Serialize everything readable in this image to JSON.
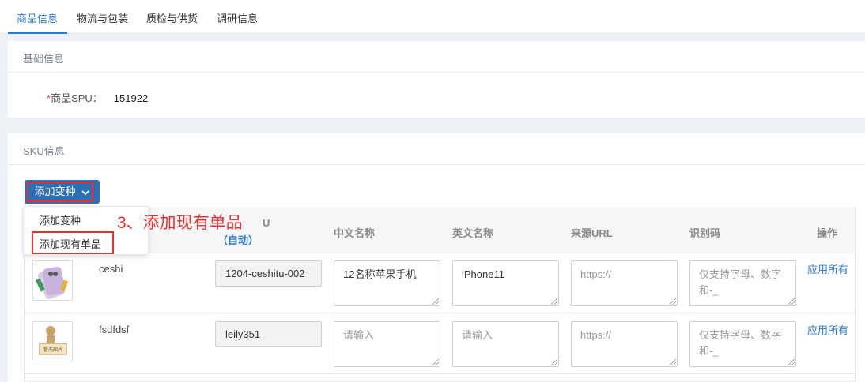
{
  "tabs": [
    {
      "label": "商品信息",
      "active": true
    },
    {
      "label": "物流与包装",
      "active": false
    },
    {
      "label": "质检与供货",
      "active": false
    },
    {
      "label": "调研信息",
      "active": false
    }
  ],
  "basic": {
    "title": "基础信息",
    "spu_required_mark": "*",
    "spu_label": "商品SPU：",
    "spu_value": "151922"
  },
  "sku": {
    "title": "SKU信息",
    "add_variant_button": "添加变种",
    "dropdown": {
      "items": [
        "添加变种",
        "添加现有单品"
      ]
    },
    "annotation": "3、添加现有单品",
    "columns": {
      "sku_partial": "U",
      "sku_sub": "（自动）",
      "cn_name": "中文名称",
      "en_name": "英文名称",
      "source_url": "来源URL",
      "code": "识别码",
      "action": "操作"
    },
    "rows": [
      {
        "image": "phone-image",
        "name": "ceshi",
        "sku_code": "1204-ceshitu-002",
        "cn_name": "12名称苹果手机",
        "cn_placeholder": false,
        "en_name": "iPhone11",
        "en_placeholder": false,
        "url": "https://",
        "code_line1": "仅支持字母、数字",
        "code_line2": "和-_",
        "action": "应用所有"
      },
      {
        "image": "no-image-placeholder",
        "image_caption": "暂无图片",
        "name": "fsdfdsf",
        "sku_code": "leily351",
        "cn_name": "请输入",
        "cn_placeholder": true,
        "en_name": "请输入",
        "en_placeholder": true,
        "url": "https://",
        "code_line1": "仅支持字母、数字",
        "code_line2": "和-_",
        "action": "应用所有"
      }
    ]
  },
  "colors": {
    "accent": "#2d7ad0",
    "button": "#2d6fb5",
    "highlight": "#e8312f"
  }
}
